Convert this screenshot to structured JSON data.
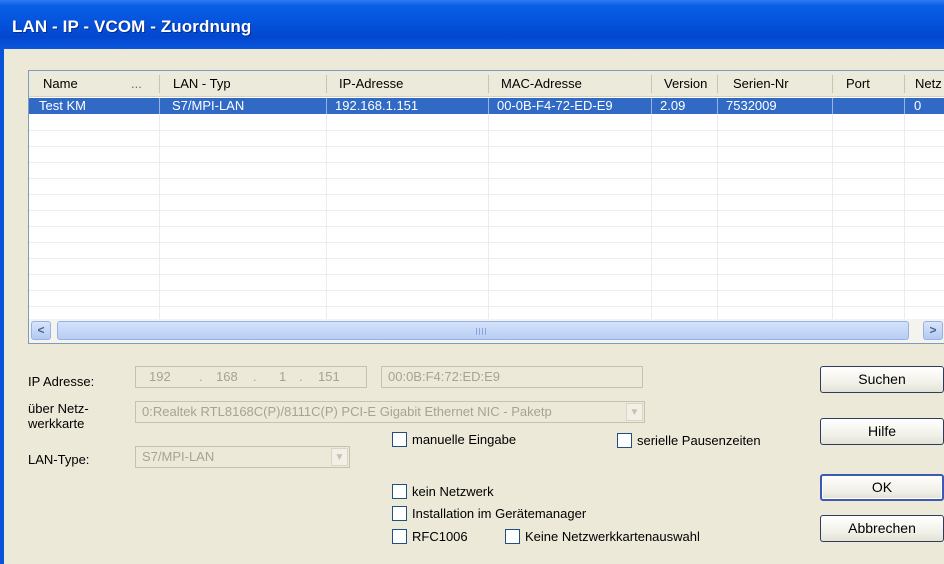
{
  "window": {
    "title": "LAN - IP - VCOM - Zuordnung"
  },
  "list": {
    "headers": [
      "Name",
      "...",
      "LAN - Typ",
      "IP-Adresse",
      "MAC-Adresse",
      "Version",
      "Serien-Nr",
      "Port",
      "Netz"
    ],
    "rows": [
      {
        "name": "Test KM",
        "lan_typ": "S7/MPI-LAN",
        "ip": "192.168.1.151",
        "mac": "00-0B-F4-72-ED-E9",
        "version": "2.09",
        "serien_nr": "7532009",
        "port": "",
        "netz": "0"
      }
    ],
    "scrollbar": {
      "left_arrow": "<",
      "right_arrow": ">"
    }
  },
  "form": {
    "ip_label": "IP Adresse:",
    "ip_octets": [
      "192",
      "168",
      "1",
      "151"
    ],
    "ip_dot": ".",
    "mac_value": "00:0B:F4:72:ED:E9",
    "nic_label_line1": "über Netz-",
    "nic_label_line2": "werkkarte",
    "nic_value": "0:Realtek RTL8168C(P)/8111C(P) PCI-E Gigabit Ethernet NIC - Paketp",
    "lan_type_label": "LAN-Type:",
    "lan_type_value": "S7/MPI-LAN"
  },
  "checkboxes": {
    "manuelle": {
      "label": "manuelle Eingabe",
      "checked": false
    },
    "seriell": {
      "label": "serielle Pausenzeiten",
      "checked": false
    },
    "kein_netzwerk": {
      "label": "kein Netzwerk",
      "checked": false
    },
    "installation": {
      "label": "Installation im Gerätemanager",
      "checked": false
    },
    "rfc1006": {
      "label": "RFC1006",
      "checked": false
    },
    "keine_nic": {
      "label": "Keine Netzwerkkartenauswahl",
      "checked": false
    }
  },
  "buttons": {
    "suchen": "Suchen",
    "hilfe": "Hilfe",
    "ok": "OK",
    "abbrechen": "Abbrechen"
  },
  "colors": {
    "title_bar": "#0453dc",
    "selection": "#316ac5",
    "dialog_bg": "#ece9d8"
  }
}
